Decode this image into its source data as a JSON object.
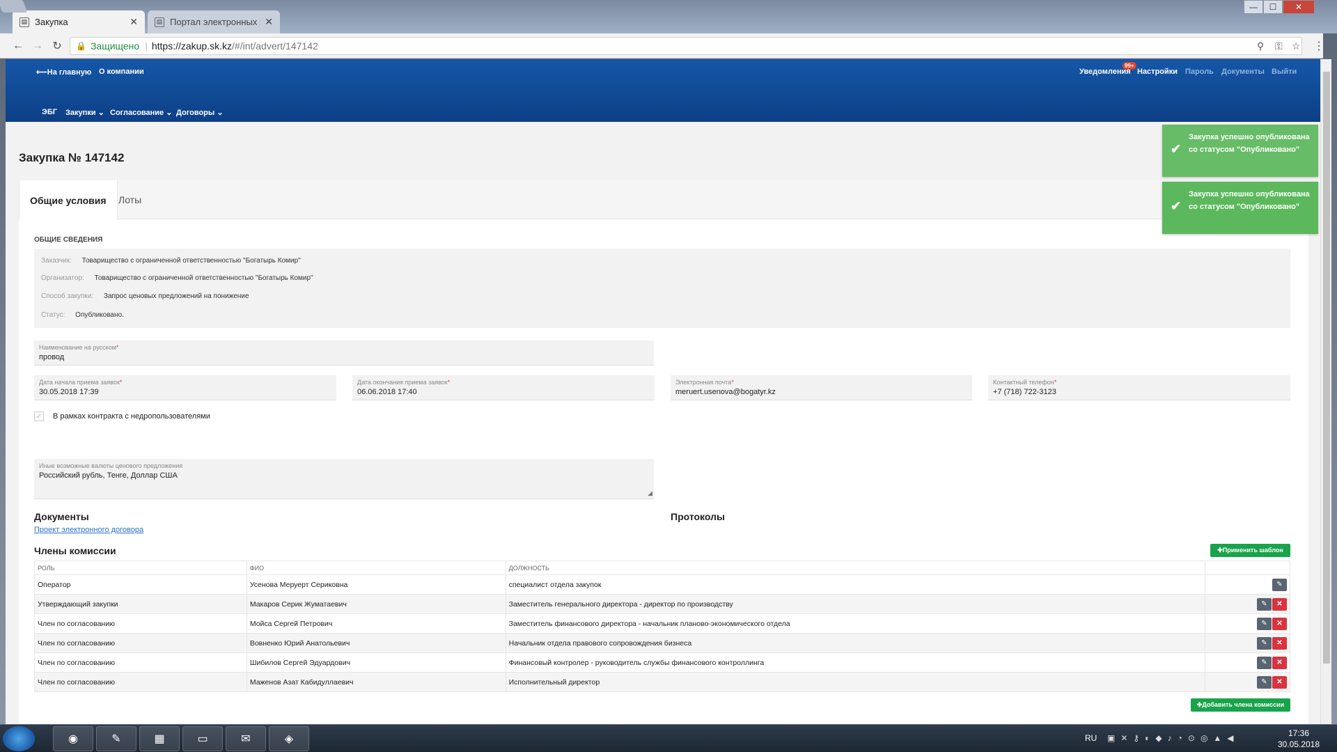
{
  "browser": {
    "tabs": [
      {
        "title": "Закупка",
        "icon": "page-icon"
      },
      {
        "title": "Портал электронных за",
        "icon": "page-icon"
      }
    ],
    "omnibox": {
      "secure_label": "Защищено",
      "url_host": "https://zakup.sk.kz",
      "url_path": "/#/int/advert/147142"
    },
    "window_buttons": {
      "minimize": "—",
      "maximize": "☐",
      "close": "✕"
    }
  },
  "header": {
    "home_link": "⟵На главную",
    "about_link": "О компании",
    "notifications": "Уведомления",
    "notifications_badge": "99+",
    "settings": "Настройки",
    "password": "Пароль",
    "documents": "Документы",
    "exit": "Выйти",
    "menu": [
      {
        "label": "ЭБГ"
      },
      {
        "label": "Закупки ⌄"
      },
      {
        "label": "Согласование ⌄"
      },
      {
        "label": "Договоры ⌄"
      }
    ]
  },
  "page": {
    "title": "Закупка № 147142",
    "tabs": [
      {
        "label": "Общие условия",
        "active": true
      },
      {
        "label": "Лоты",
        "active": false
      }
    ]
  },
  "general": {
    "section_title": "ОБЩИЕ СВЕДЕНИЯ",
    "customer_label": "Заказчик:",
    "customer": "Товарищество с ограниченной ответственностью \"Богатырь Комир\"",
    "organizer_label": "Организатор:",
    "organizer": "Товарищество с ограниченной ответственностью \"Богатырь Комир\"",
    "method_label": "Способ закупки:",
    "method": "Запрос ценовых предложений на понижение",
    "status_label": "Статус:",
    "status": "Опубликовано."
  },
  "form": {
    "name_label": "Наименование на русском",
    "name_value": "провод",
    "start_label": "Дата начала приема заявок",
    "start_value": "30.05.2018 17:39",
    "end_label": "Дата окончания приема заявок",
    "end_value": "06.06.2018 17:40",
    "email_label": "Электронная почта",
    "email_value": "meruert.usenova@bogatyr.kz",
    "phone_label": "Контактный телефон",
    "phone_value": "+7 (718) 722-3123",
    "subsoil_checkbox_label": "В рамках контракта с недропользователями",
    "currency_label": "Иные возможные валюты ценового предложения",
    "currency_value": "Российский  рубль, Тенге, Доллар США"
  },
  "documents": {
    "title": "Документы",
    "link": "Проект электронного договора"
  },
  "protocols": {
    "title": "Протоколы"
  },
  "commission": {
    "title": "Члены комиссии",
    "apply_template_button": "✚Применить шаблон",
    "add_member_button": "✚Добавить члена комиссии",
    "columns": {
      "role": "Роль",
      "fio": "ФИО",
      "position": "Должность"
    },
    "rows": [
      {
        "role": "Оператор",
        "fio": "Усенова Меруерт Сериковна",
        "position": "специалист отдела закупок",
        "deletable": false
      },
      {
        "role": "Утверждающий закупки",
        "fio": "Макаров Серик Жуматаевич",
        "position": "Заместитель генерального директора - директор по производству",
        "deletable": true
      },
      {
        "role": "Член по согласованию",
        "fio": "Мойса Сергей Петрович",
        "position": "Заместитель финансового директора - начальник планово-экономического отдела",
        "deletable": true
      },
      {
        "role": "Член по согласованию",
        "fio": "Вовненко Юрий Анатольевич",
        "position": "Начальник отдела правового сопровождения бизнеса",
        "deletable": true
      },
      {
        "role": "Член по согласованию",
        "fio": "Шибилов Сергей Эдуардович",
        "position": "Финансовый контролер - руководитель службы финансового контроллинга",
        "deletable": true
      },
      {
        "role": "Член по согласованию",
        "fio": "Маженов Азат Кабидуллаевич",
        "position": "Исполнительный директор",
        "deletable": true
      }
    ]
  },
  "toasts": [
    {
      "message": "Закупка успешно опубликована со статусом \"Опубликовано\""
    },
    {
      "message": "Закупка успешно опубликована со статусом \"Опубликовано\""
    }
  ],
  "taskbar": {
    "lang": "RU",
    "time": "17:36",
    "date": "30.05.2018"
  },
  "colors": {
    "header": "#1557a8",
    "success": "#5cb85c",
    "green_button": "#19a34a",
    "danger": "#d9333f"
  }
}
